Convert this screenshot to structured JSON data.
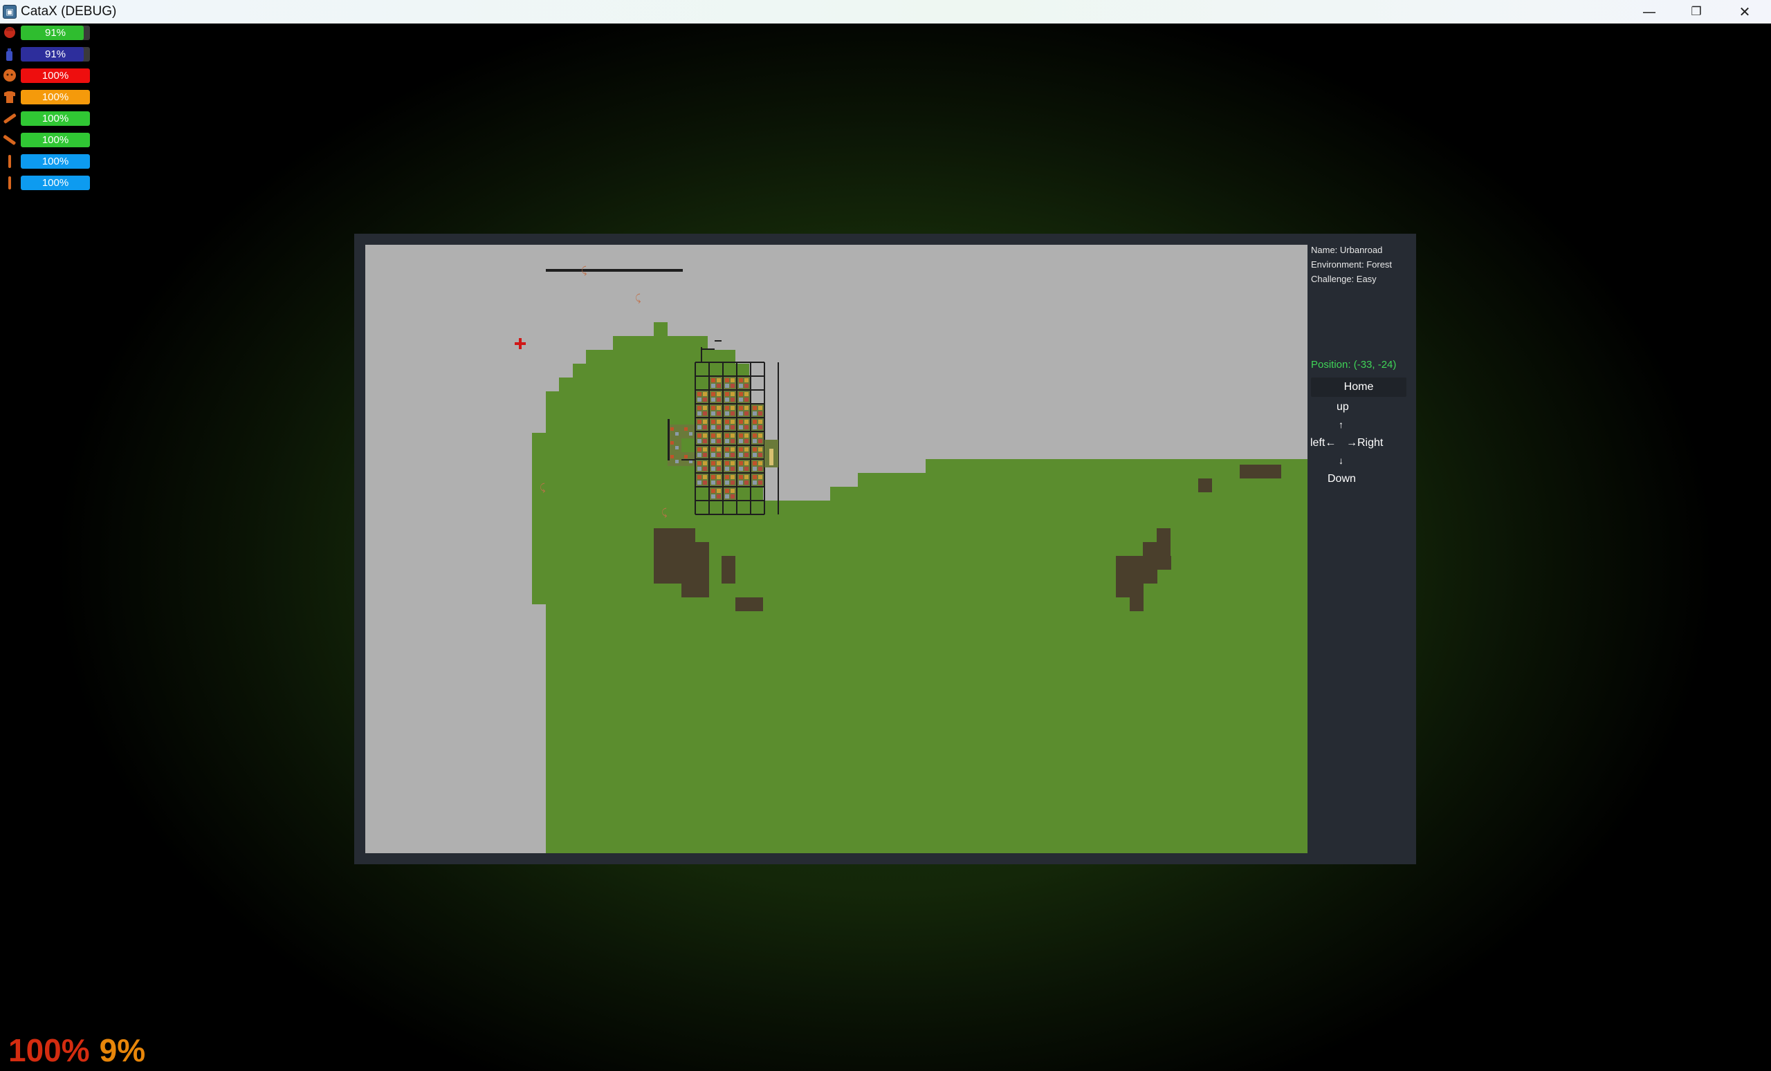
{
  "window": {
    "title": "CataX (DEBUG)",
    "minimize_glyph": "—",
    "restore_glyph": "❐",
    "close_glyph": "✕"
  },
  "stats": [
    {
      "icon": "head-icon",
      "label": "91%",
      "value": 0.91,
      "color": "#2fbd2f"
    },
    {
      "icon": "torso-bottle-icon",
      "label": "91%",
      "value": 0.91,
      "color": "#2d2e9c"
    },
    {
      "icon": "face-icon",
      "label": "100%",
      "value": 1.0,
      "color": "#ee0e0e"
    },
    {
      "icon": "shirt-icon",
      "label": "100%",
      "value": 1.0,
      "color": "#f59a0b"
    },
    {
      "icon": "left-arm-icon",
      "label": "100%",
      "value": 1.0,
      "color": "#30c734"
    },
    {
      "icon": "right-arm-icon",
      "label": "100%",
      "value": 1.0,
      "color": "#30c734"
    },
    {
      "icon": "left-leg-icon",
      "label": "100%",
      "value": 1.0,
      "color": "#0d9bf0"
    },
    {
      "icon": "right-leg-icon",
      "label": "100%",
      "value": 1.0,
      "color": "#0d9bf0"
    }
  ],
  "overmap": {
    "info": {
      "name": "Name: Urbanroad",
      "environment": "Environment: Forest",
      "challenge": "Challenge: Easy"
    },
    "position": "Position: (-33, -24)",
    "home_button": "Home",
    "nav": {
      "up": "up",
      "up_arrow": "↑",
      "left": "left←",
      "right": "→Right",
      "down_arrow": "↓",
      "down": "Down"
    }
  },
  "hud": {
    "health": "100%",
    "stamina": "9%"
  },
  "colors": {
    "grass": "#5b8d2e",
    "unexplored": "#b0b0b0",
    "road": "#1e1e1e",
    "dirt": "#4a3f2c",
    "player_marker": "#d01818"
  }
}
